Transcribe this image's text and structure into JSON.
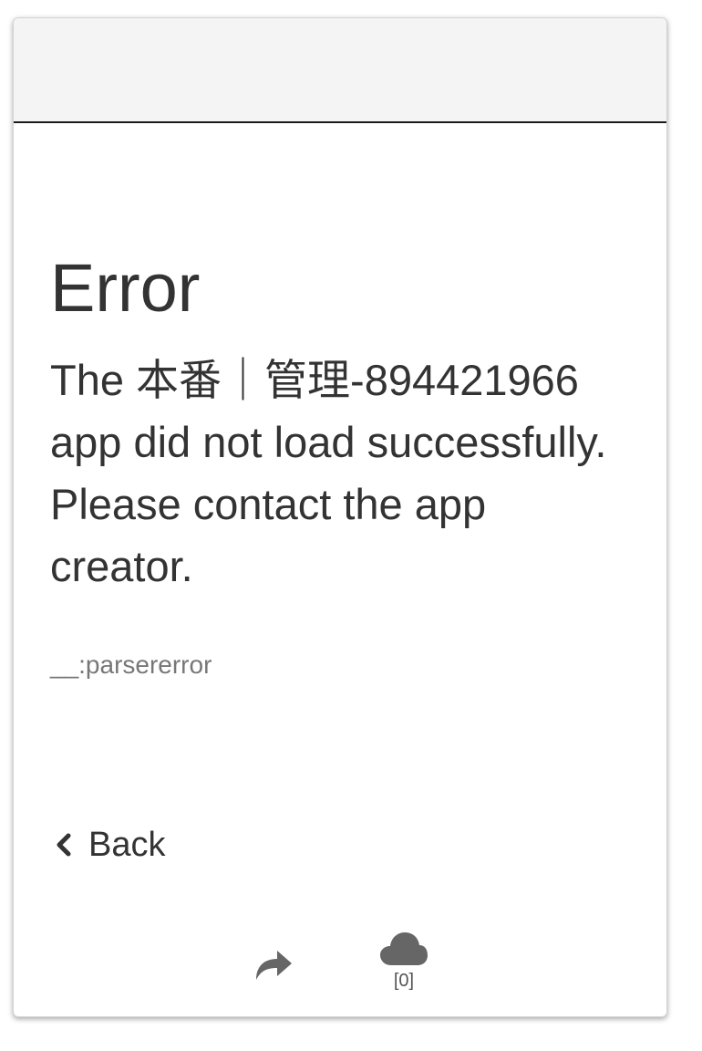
{
  "error": {
    "title": "Error",
    "message": "The 本番｜管理-894421966 app did not load successfully. Please contact the app creator.",
    "detail": "__:parsererror"
  },
  "nav": {
    "back_label": "Back",
    "back_icon": "chevron-left-icon"
  },
  "footer": {
    "share_icon": "share-forward-icon",
    "cloud_icon": "cloud-icon",
    "cloud_count": "[0]"
  },
  "colors": {
    "header_bg": "#f4f4f4",
    "text": "#333333",
    "muted_text": "#777777",
    "icon": "#666666"
  }
}
